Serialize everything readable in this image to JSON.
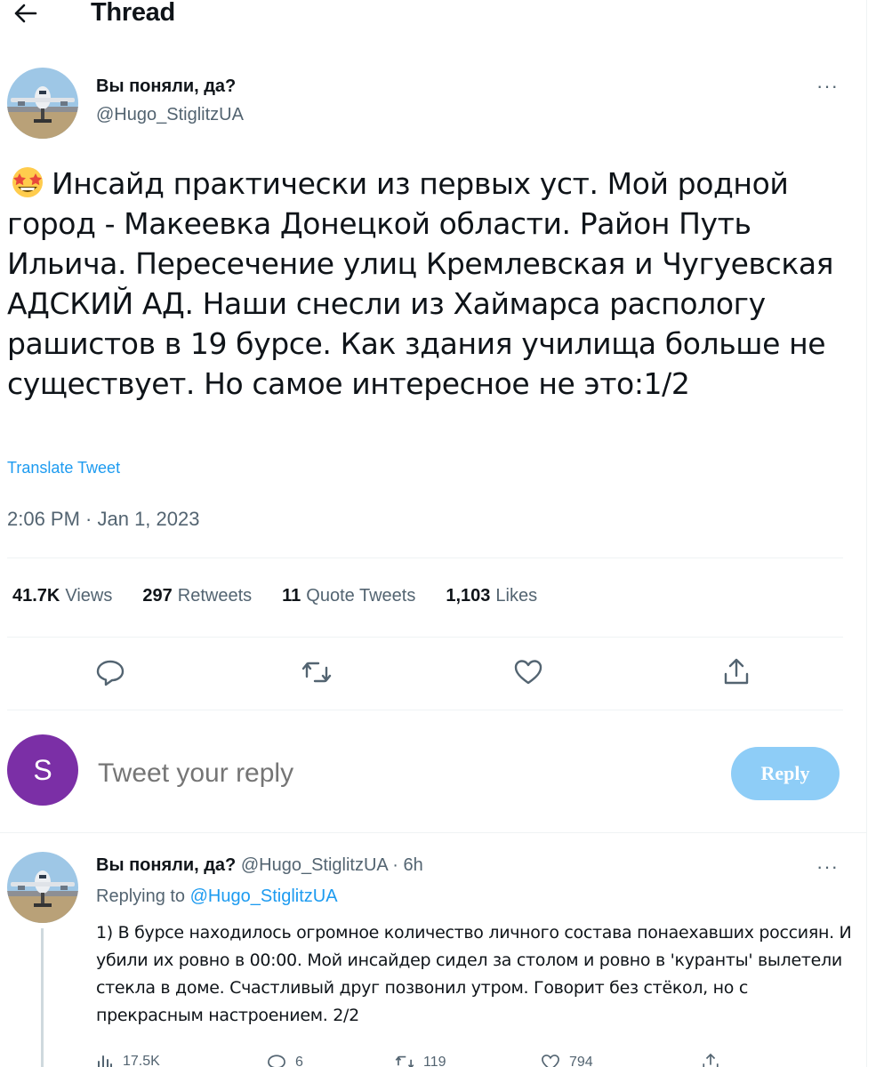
{
  "header": {
    "back_icon": "arrow-left-icon",
    "title": "Thread"
  },
  "main_tweet": {
    "author_name": "Вы поняли, да?",
    "author_handle": "@Hugo_StiglitzUA",
    "more_label": "···",
    "text": "Инсайд практически из первых уст. Мой родной город - Макеевка Донецкой области. Район Путь Ильича. Пересечение улиц Кремлевская и Чугуевская АДСКИЙ АД. Наши снесли из Хаймарса распологу рашистов в 19 бурсе. Как здания училища больше не существует. Но самое интересное не это:1/2",
    "emoji": "star-struck-emoji",
    "translate_label": "Translate Tweet",
    "timestamp": "2:06 PM · Jan 1, 2023",
    "stats": {
      "views_count": "41.7K",
      "views_label": "Views",
      "retweets_count": "297",
      "retweets_label": "Retweets",
      "quotes_count": "11",
      "quotes_label": "Quote Tweets",
      "likes_count": "1,103",
      "likes_label": "Likes"
    },
    "actions": [
      "reply-icon",
      "retweet-icon",
      "like-icon",
      "share-icon"
    ]
  },
  "composer": {
    "avatar_letter": "S",
    "placeholder": "Tweet your reply",
    "reply_button": "Reply"
  },
  "reply_tweet": {
    "author_name": "Вы поняли, да?",
    "meta": "@Hugo_StiglitzUA · 6h",
    "more_label": "···",
    "replying_prefix": "Replying to",
    "replying_mention": "@Hugo_StiglitzUA",
    "text": "1) В бурсе находилось огромное количество личного состава понаехавших россиян. И убили их ровно в 00:00. Мой инсайдер сидел за столом и ровно в 'куранты' вылетели стекла в доме. Счастливый друг позвонил утром. Говорит без стёкол, но с прекрасным настроением. 2/2",
    "actions": [
      {
        "icon": "views-icon",
        "count": "17.5K"
      },
      {
        "icon": "reply-icon",
        "count": "6"
      },
      {
        "icon": "retweet-icon",
        "count": "119"
      },
      {
        "icon": "like-icon",
        "count": "794"
      },
      {
        "icon": "share-icon",
        "count": ""
      }
    ]
  },
  "colors": {
    "accent": "#1d9bf0",
    "reply_button_disabled": "#8ecdf7",
    "muted_text": "#536471",
    "composer_avatar": "#7b2fa6"
  }
}
